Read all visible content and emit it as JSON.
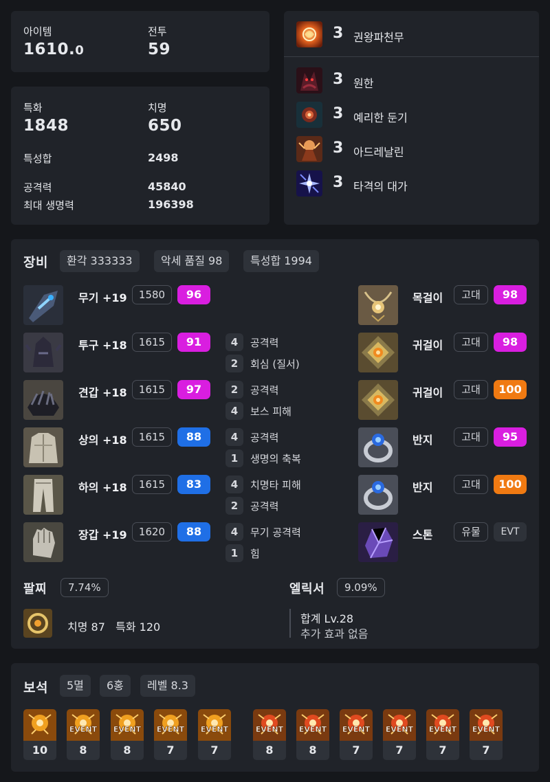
{
  "summary": {
    "item_label": "아이템",
    "item_value": "1610.",
    "item_value_frac": "0",
    "combat_label": "전투",
    "combat_value": "59"
  },
  "stats": {
    "spec_label": "특화",
    "spec_value": "1848",
    "crit_label": "치명",
    "crit_value": "650",
    "total_label": "특성합",
    "total_value": "2498",
    "atk_label": "공격력",
    "atk_value": "45840",
    "hp_label": "최대 생명력",
    "hp_value": "196398"
  },
  "engravings": [
    {
      "level": "3",
      "name": "권왕파천무",
      "icon": "fist-flame-icon"
    },
    {
      "level": "3",
      "name": "원한",
      "icon": "grudge-demon-icon"
    },
    {
      "level": "3",
      "name": "예리한 둔기",
      "icon": "keen-blunt-icon"
    },
    {
      "level": "3",
      "name": "아드레날린",
      "icon": "adrenaline-icon"
    },
    {
      "level": "3",
      "name": "타격의 대가",
      "icon": "hit-master-icon"
    }
  ],
  "equipment": {
    "title": "장비",
    "chips": [
      "환각 333333",
      "악세 품질 98",
      "특성합 1994"
    ],
    "armor": [
      {
        "name": "무기 +19",
        "ilvl": "1580",
        "quality": "96",
        "qcolor": "#d91ee0",
        "icon": "weapon-gauntlet-icon",
        "effects": []
      },
      {
        "name": "투구 +18",
        "ilvl": "1615",
        "quality": "91",
        "qcolor": "#d91ee0",
        "icon": "helmet-icon",
        "effects": [
          {
            "lv": "4",
            "text": "공격력"
          },
          {
            "lv": "2",
            "text": "회심 (질서)"
          }
        ]
      },
      {
        "name": "견갑 +18",
        "ilvl": "1615",
        "quality": "97",
        "qcolor": "#d91ee0",
        "icon": "shoulder-icon",
        "effects": [
          {
            "lv": "2",
            "text": "공격력"
          },
          {
            "lv": "4",
            "text": "보스 피해"
          }
        ]
      },
      {
        "name": "상의 +18",
        "ilvl": "1615",
        "quality": "88",
        "qcolor": "#1f6fe6",
        "icon": "chest-armor-icon",
        "effects": [
          {
            "lv": "4",
            "text": "공격력"
          },
          {
            "lv": "1",
            "text": "생명의 축복"
          }
        ]
      },
      {
        "name": "하의 +18",
        "ilvl": "1615",
        "quality": "83",
        "qcolor": "#1f6fe6",
        "icon": "leg-armor-icon",
        "effects": [
          {
            "lv": "4",
            "text": "치명타 피해"
          },
          {
            "lv": "2",
            "text": "공격력"
          }
        ]
      },
      {
        "name": "장갑 +19",
        "ilvl": "1620",
        "quality": "88",
        "qcolor": "#1f6fe6",
        "icon": "glove-icon",
        "effects": [
          {
            "lv": "4",
            "text": "무기 공격력"
          },
          {
            "lv": "1",
            "text": "힘"
          }
        ]
      }
    ],
    "accessories": [
      {
        "name": "목걸이",
        "grade": "고대",
        "quality": "98",
        "qcolor": "#d91ee0",
        "icon": "necklace-icon"
      },
      {
        "name": "귀걸이",
        "grade": "고대",
        "quality": "98",
        "qcolor": "#d91ee0",
        "icon": "earring-icon"
      },
      {
        "name": "귀걸이",
        "grade": "고대",
        "quality": "100",
        "qcolor": "#f07a12",
        "icon": "earring-icon"
      },
      {
        "name": "반지",
        "grade": "고대",
        "quality": "95",
        "qcolor": "#d91ee0",
        "icon": "ring-icon"
      },
      {
        "name": "반지",
        "grade": "고대",
        "quality": "100",
        "qcolor": "#f07a12",
        "icon": "ring-icon"
      },
      {
        "name": "스톤",
        "grade": "유물",
        "quality": "EVT",
        "qcolor": "#2e3239",
        "icon": "ability-stone-icon"
      }
    ],
    "bracelet_label": "팔찌",
    "bracelet_pct": "7.74%",
    "bracelet_effects": "치명 87   특화 120",
    "elixir_label": "엘릭서",
    "elixir_pct": "9.09%",
    "elixir_total": "합계 Lv.28",
    "elixir_extra": "추가 효과 없음"
  },
  "gems": {
    "title": "보석",
    "chips": [
      "5멸",
      "6홍",
      "레벨 8.3"
    ],
    "event_label": "EVENT",
    "items": [
      {
        "level": "10",
        "type": "orange",
        "event": false
      },
      {
        "level": "8",
        "type": "orange",
        "event": true
      },
      {
        "level": "8",
        "type": "orange",
        "event": true
      },
      {
        "level": "7",
        "type": "orange",
        "event": true
      },
      {
        "level": "7",
        "type": "orange",
        "event": true
      },
      {
        "level": "8",
        "type": "red",
        "event": true
      },
      {
        "level": "8",
        "type": "red",
        "event": true
      },
      {
        "level": "7",
        "type": "red",
        "event": true
      },
      {
        "level": "7",
        "type": "red",
        "event": true
      },
      {
        "level": "7",
        "type": "red",
        "event": true
      },
      {
        "level": "7",
        "type": "red",
        "event": true
      }
    ]
  },
  "colors": {
    "legendary_purple": "#d91ee0",
    "blue": "#1f6fe6",
    "ancient_orange": "#f07a12",
    "card_bg": "#202329",
    "page_bg": "#15171b"
  }
}
